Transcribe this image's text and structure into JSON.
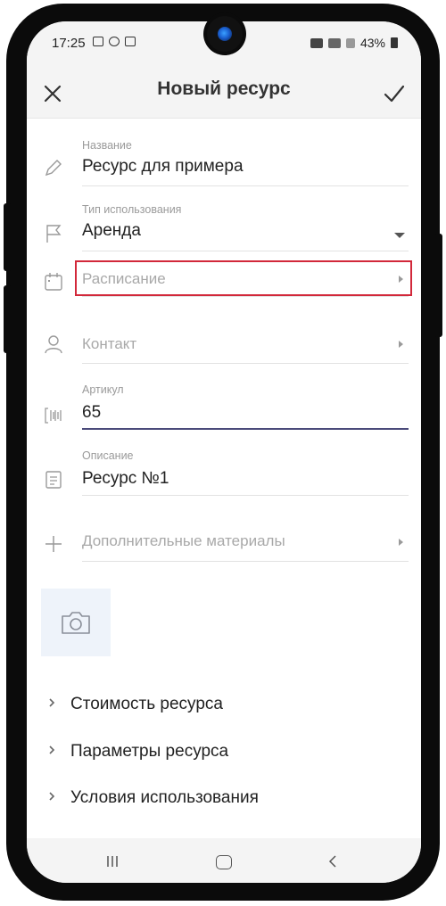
{
  "status": {
    "time": "17:25",
    "battery": "43%"
  },
  "header": {
    "title": "Новый ресурс"
  },
  "fields": {
    "name": {
      "label": "Название",
      "value": "Ресурс для примера"
    },
    "usage_type": {
      "label": "Тип использования",
      "value": "Аренда"
    },
    "schedule": {
      "placeholder": "Расписание"
    },
    "contact": {
      "placeholder": "Контакт"
    },
    "article": {
      "label": "Артикул",
      "value": "65"
    },
    "description": {
      "label": "Описание",
      "value": "Ресурс №1"
    },
    "extras": {
      "placeholder": "Дополнительные материалы"
    }
  },
  "sections": [
    {
      "label": "Стоимость ресурса"
    },
    {
      "label": "Параметры ресурса"
    },
    {
      "label": "Условия использования"
    }
  ],
  "icons": [
    "close-icon",
    "check-icon",
    "pencil-icon",
    "flag-icon",
    "calendar-icon",
    "person-icon",
    "barcode-icon",
    "document-icon",
    "plus-icon",
    "camera-icon",
    "chevron-right-icon"
  ],
  "colors": {
    "highlight": "#d2283a",
    "active_underline": "#4a4a7a",
    "chrome": "#f4f4f4",
    "photo_bg": "#eef3fa"
  }
}
